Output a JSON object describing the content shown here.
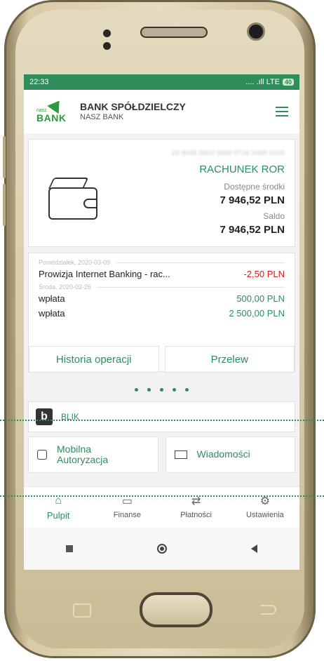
{
  "status_bar": {
    "time": "22:33",
    "signal": ".... .ıll LTE",
    "battery": "40"
  },
  "header": {
    "logo_top": "nasz",
    "logo_bottom": "BANK",
    "bank_title": "BANK SPÓŁDZIELCZY",
    "bank_subtitle": "NASZ BANK"
  },
  "account": {
    "number_blurred": "29 9045 0002 0000 0726 0000 0010",
    "name": "RACHUNEK ROR",
    "available_label": "Dostępne środki",
    "available_value": "7 946,52 PLN",
    "balance_label": "Saldo",
    "balance_value": "7 946,52 PLN"
  },
  "operations": {
    "date1": "Poniedziałek, 2020-03-09",
    "date2": "Środa, 2020-02-26",
    "items": [
      {
        "title": "Prowizja Internet Banking - rac...",
        "amount": "-2,50 PLN"
      },
      {
        "title": "wpłata",
        "amount": "500,00 PLN"
      },
      {
        "title": "wpłata",
        "amount": "2 500,00 PLN"
      }
    ]
  },
  "actions": {
    "history": "Historia operacji",
    "transfer": "Przelew"
  },
  "blik": {
    "logo": "b",
    "label": "BLIK"
  },
  "tiles": {
    "mobile_auth_line1": "Mobilna",
    "mobile_auth_line2": "Autoryzacja",
    "messages": "Wiadomości"
  },
  "bottom_nav": [
    {
      "label": "Pulpit",
      "icon": "home-icon"
    },
    {
      "label": "Finanse",
      "icon": "wallet-icon"
    },
    {
      "label": "Płatności",
      "icon": "transfer-arrows-icon"
    },
    {
      "label": "Ustawienia",
      "icon": "gear-icon"
    }
  ],
  "colors": {
    "brand_green": "#2f8d5c",
    "negative": "#d71920"
  }
}
